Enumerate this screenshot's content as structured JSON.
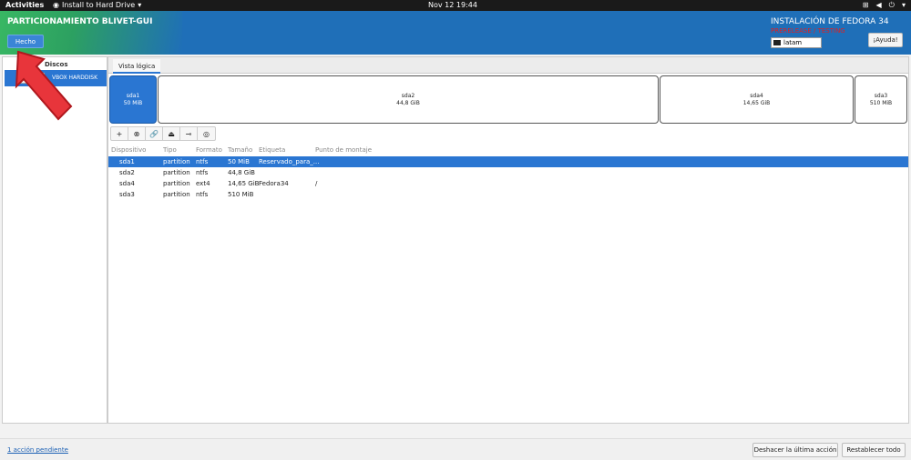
{
  "topbar": {
    "activities": "Activities",
    "app_name": "Install to Hard Drive",
    "clock": "Nov 12  19:44"
  },
  "header": {
    "title": "PARTICIONAMIENTO BLIVET-GUI",
    "done_label": "Hecho",
    "install_title": "INSTALACIÓN DE FEDORA 34",
    "warning": "PRERELEASE / TESTING",
    "keyboard": "latam",
    "help_label": "¡Ayuda!"
  },
  "sidebar": {
    "section": "Discos",
    "disk_label": "VBOX HARDDISK"
  },
  "main": {
    "tab": "Vista lógica",
    "partitions": [
      {
        "name": "sda1",
        "size": "50 MiB"
      },
      {
        "name": "sda2",
        "size": "44,8 GiB"
      },
      {
        "name": "sda4",
        "size": "14,65 GiB"
      },
      {
        "name": "sda3",
        "size": "510 MiB"
      }
    ],
    "columns": [
      "Dispositivo",
      "Tipo",
      "Formato",
      "Tamaño",
      "Etiqueta",
      "Punto de montaje"
    ],
    "rows": [
      [
        "sda1",
        "partition",
        "ntfs",
        "50 MiB",
        "Reservado_para_...",
        ""
      ],
      [
        "sda2",
        "partition",
        "ntfs",
        "44,8 GiB",
        "",
        ""
      ],
      [
        "sda4",
        "partition",
        "ext4",
        "14,65 GiB",
        "Fedora34",
        "/"
      ],
      [
        "sda3",
        "partition",
        "ntfs",
        "510 MiB",
        "",
        ""
      ]
    ]
  },
  "footer": {
    "pending": "1 acción pendiente",
    "undo_label": "Deshacer la última acción",
    "reset_label": "Restablecer todo"
  },
  "colors": {
    "accent": "#2a76d2",
    "header": "#1f6fb8",
    "warning": "#e02020",
    "arrow": "#e8353b"
  }
}
